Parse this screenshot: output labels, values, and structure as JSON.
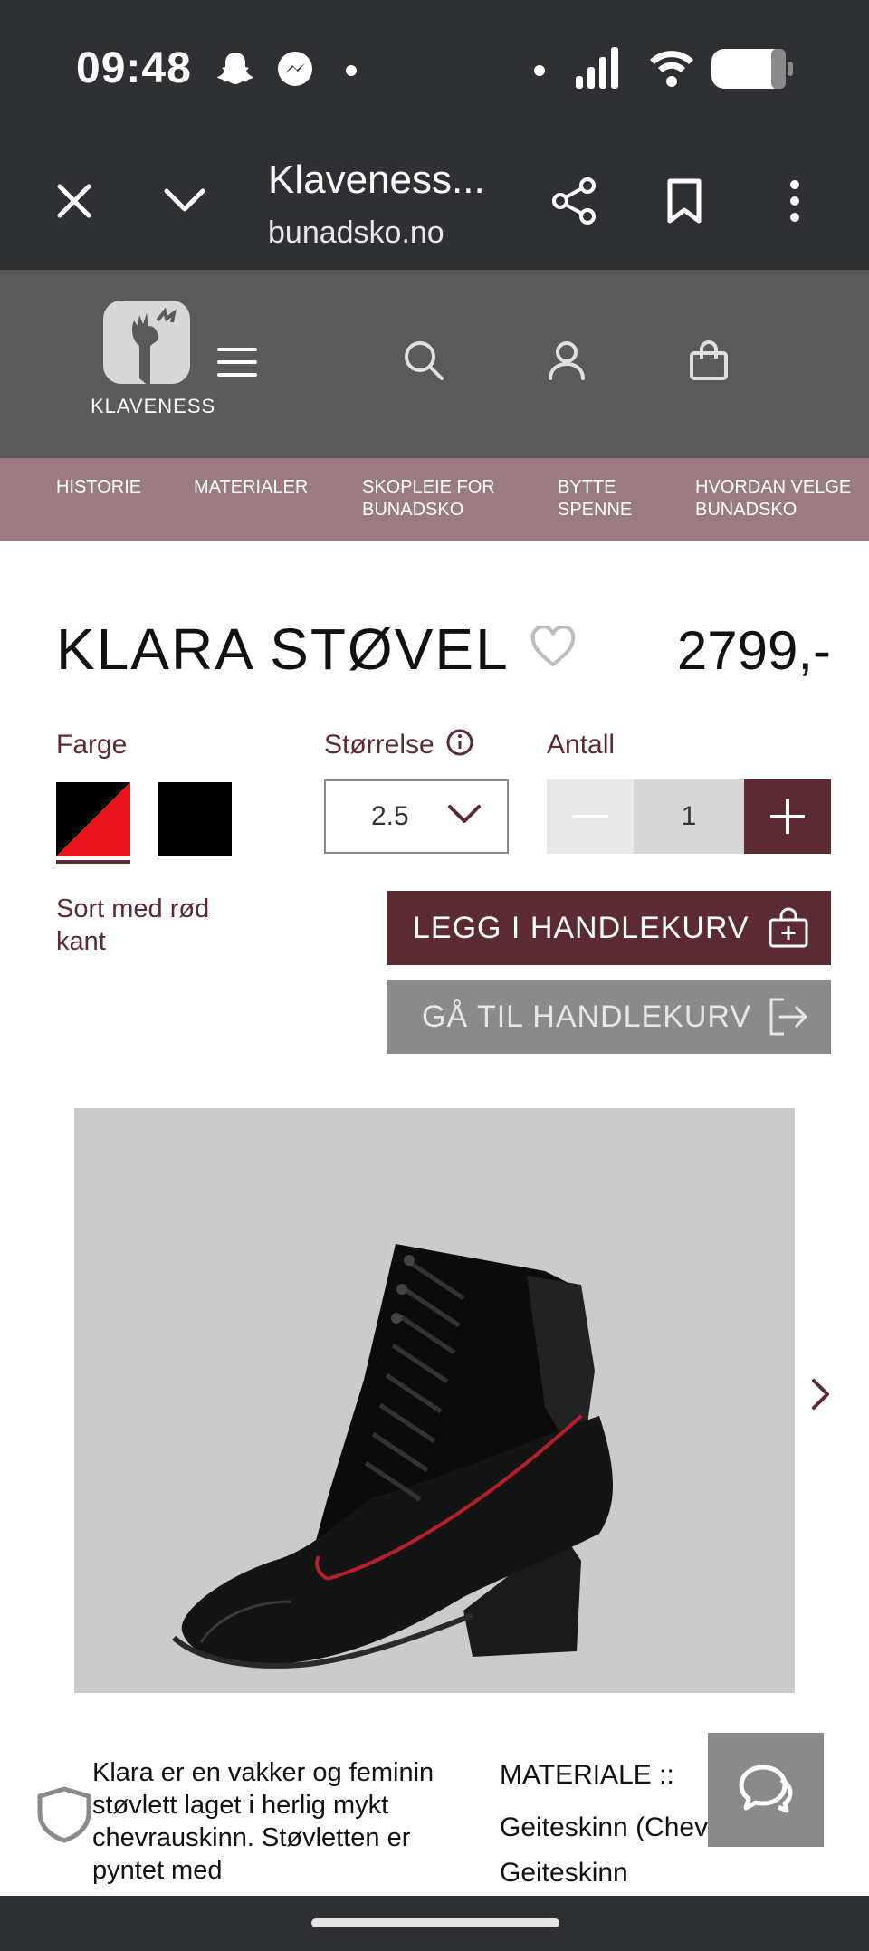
{
  "status_bar": {
    "time": "09:48",
    "icons": [
      "snapchat-icon",
      "messenger-icon",
      "dot-icon",
      "dot-icon",
      "signal-icon",
      "wifi-icon",
      "battery-icon"
    ]
  },
  "browser": {
    "title": "Klaveness...",
    "url": "bunadsko.no"
  },
  "site": {
    "logo_text": "KLAVENESS",
    "nav_items": [
      "HISTORIE",
      "MATERIALER",
      "SKOPLEIE FOR BUNADSKO",
      "BYTTE SPENNE",
      "HVORDAN VELGE BUNADSKO"
    ]
  },
  "product": {
    "title": "KLARA STØVEL",
    "price": "2799,-",
    "color_label": "Farge",
    "size_label": "Størrelse",
    "quantity_label": "Antall",
    "color_name": "Sort med rød kant",
    "size_value": "2.5",
    "quantity_value": "1",
    "add_to_cart": "LEGG I HANDLEKURV",
    "go_to_cart": "GÅ TIL HANDLEKURV",
    "description": "Klara er en vakker og feminin støvlett laget i herlig mykt chevrauskinn. Støvletten er pyntet med",
    "material_label": "MATERIALE ::",
    "material_value": "Geiteskinn (Chevreau)-Geiteskinn"
  },
  "colors": {
    "accent": "#5c2a33",
    "header_bg": "#5a5a5a",
    "nav_bg": "#9a7b81",
    "swatch_red": "#e8141c",
    "swatch_black": "#000000"
  }
}
